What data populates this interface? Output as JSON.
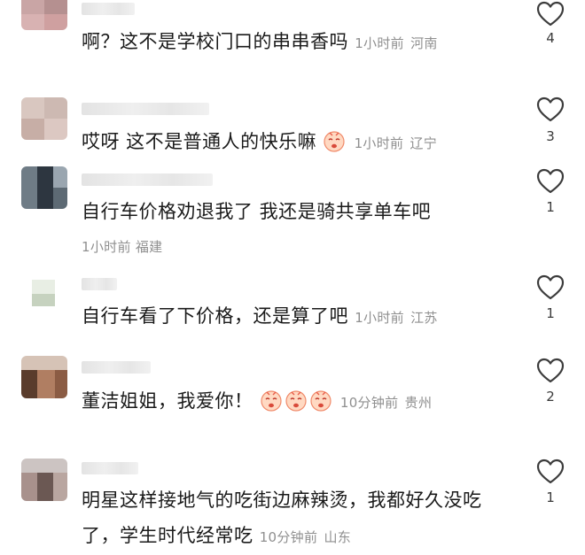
{
  "comments": [
    {
      "text": "啊？这不是学校门口的串串香吗",
      "time": "1小时前",
      "location": "河南",
      "likes": "4"
    },
    {
      "text": "哎呀 这不是普通人的快乐嘛",
      "time": "1小时前",
      "location": "辽宁",
      "likes": "3"
    },
    {
      "text": "自行车价格劝退我了 我还是骑共享单车吧",
      "time": "1小时前",
      "location": "福建",
      "likes": "1"
    },
    {
      "text": "自行车看了下价格，还是算了吧",
      "time": "1小时前",
      "location": "江苏",
      "likes": "1"
    },
    {
      "text": "董洁姐姐，我爱你！",
      "time": "10分钟前",
      "location": "贵州",
      "likes": "2"
    },
    {
      "text_line1": "明星这样接地气的吃街边麻辣烫，我都好久没吃",
      "text_line2": "了，学生时代经常吃",
      "time": "10分钟前",
      "location": "山东",
      "likes": "1"
    }
  ],
  "icons": {
    "like": "heart-outline-icon",
    "emoji": "crying-face-emoji-icon"
  }
}
